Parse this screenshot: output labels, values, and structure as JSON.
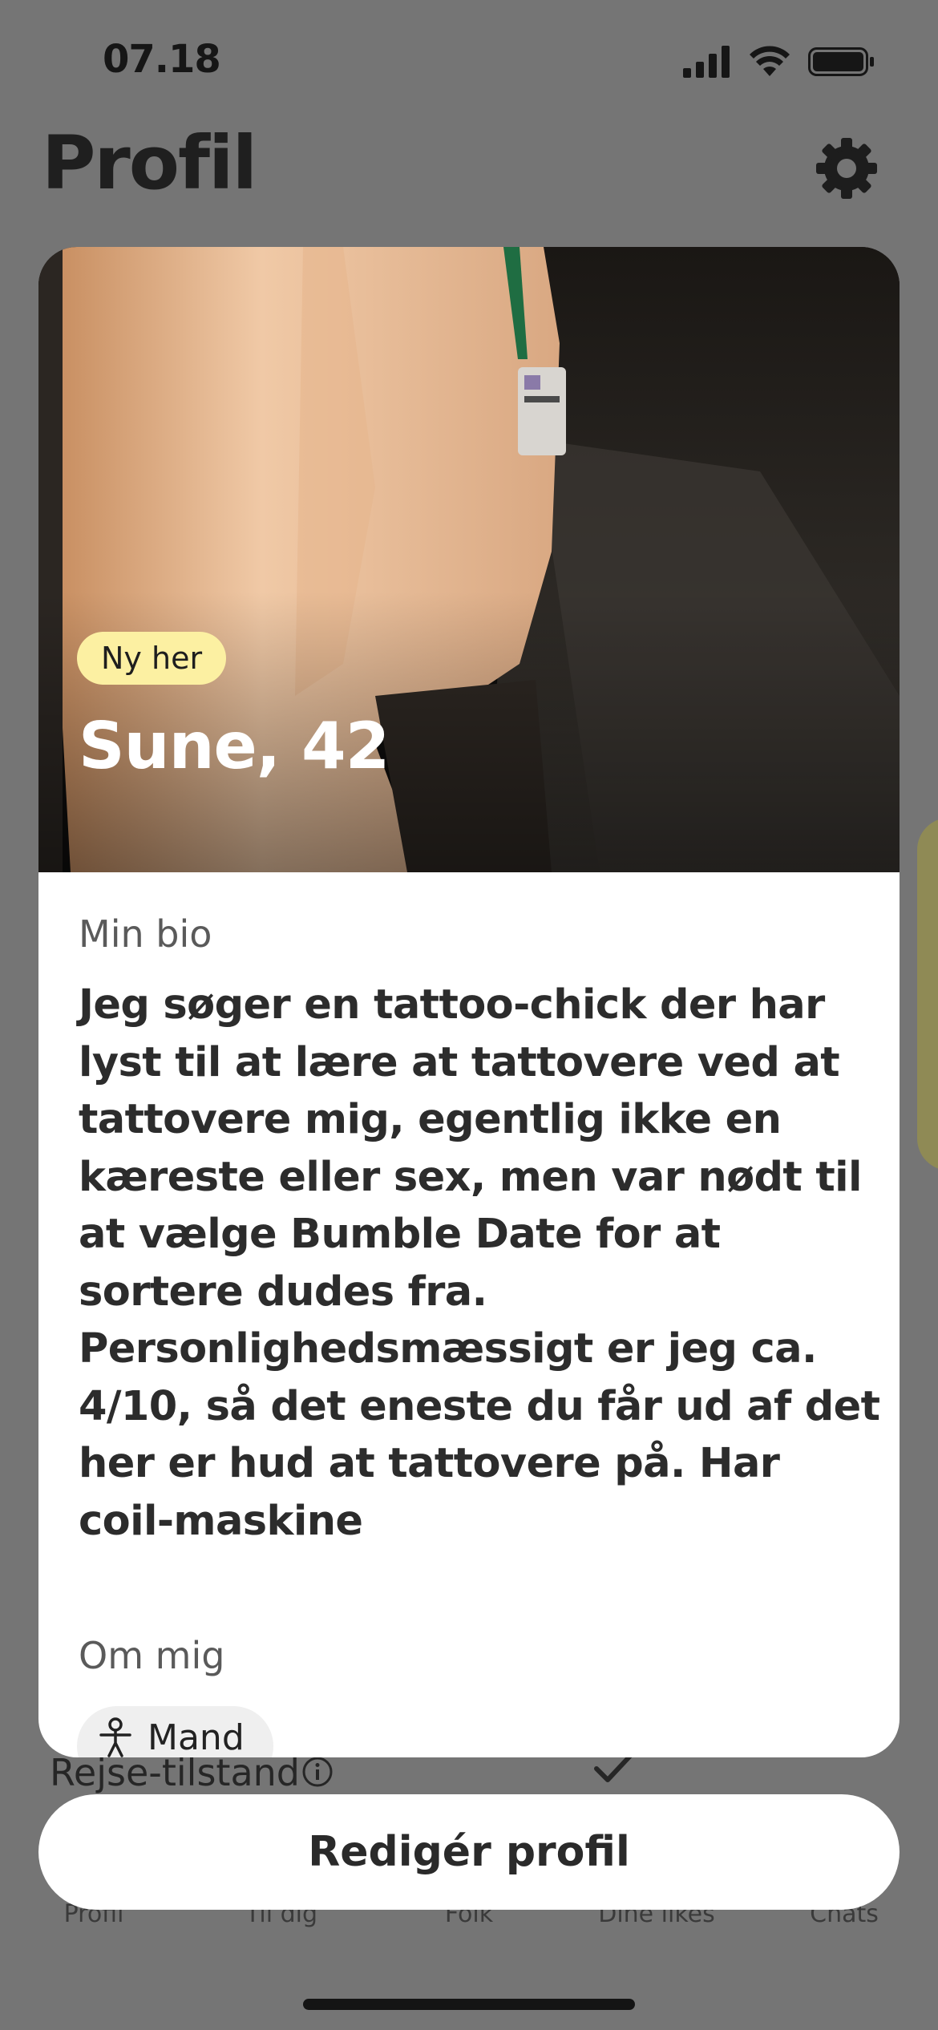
{
  "status_bar": {
    "time": "07.18",
    "signal_icon": "cellular-signal-icon",
    "wifi_icon": "wifi-icon",
    "battery_icon": "battery-icon"
  },
  "header": {
    "title": "Profil",
    "settings_icon": "gear-icon"
  },
  "profile_card": {
    "badge": "Ny her",
    "name_age": "Sune, 42",
    "bio_heading": "Min bio",
    "bio_text": "Jeg søger en tattoo-chick der har lyst til at lære at tattovere ved at tattovere mig, egentlig ikke en kæreste eller sex, men var nødt til at vælge Bumble Date for at sortere dudes fra. Personlighedsmæssigt er jeg ca. 4/10, så det eneste du får ud af det her er hud at tattovere på. Har coil-maskine",
    "about_heading": "Om mig",
    "chips": [
      {
        "label": "Mand",
        "icon": "person-icon"
      }
    ]
  },
  "background_list": {
    "travel_mode_label": "Rejse-tilstand",
    "info_icon": "info-icon",
    "check_icon": "checkmark-icon"
  },
  "edit_button_label": "Redigér profil",
  "bottom_nav": [
    {
      "label": "Profil"
    },
    {
      "label": "Til dig"
    },
    {
      "label": "Folk"
    },
    {
      "label": "Dine likes"
    },
    {
      "label": "Chats"
    }
  ],
  "colors": {
    "overlay_background": "#757575",
    "badge_background": "#fcf0a2",
    "card_background": "#ffffff"
  }
}
